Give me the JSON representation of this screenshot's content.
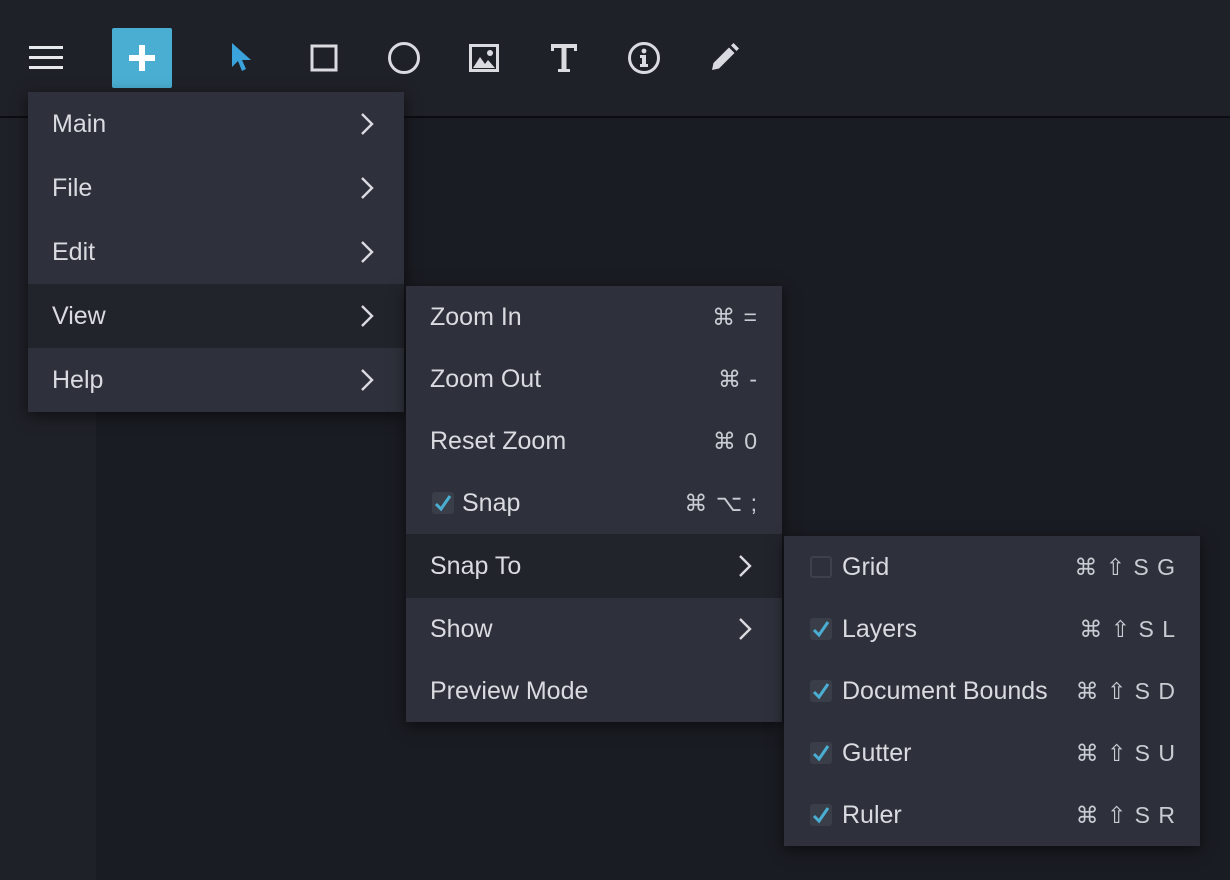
{
  "toolbar": {
    "tools": [
      {
        "name": "menu",
        "icon": "hamburger-icon"
      },
      {
        "name": "add",
        "icon": "plus-icon"
      },
      {
        "name": "select",
        "icon": "pointer-icon"
      },
      {
        "name": "rectangle",
        "icon": "square-icon"
      },
      {
        "name": "ellipse",
        "icon": "circle-icon"
      },
      {
        "name": "image",
        "icon": "image-icon"
      },
      {
        "name": "text",
        "icon": "text-icon"
      },
      {
        "name": "info",
        "icon": "info-icon"
      },
      {
        "name": "pen",
        "icon": "pencil-icon"
      }
    ],
    "accent_color": "#4aaed2",
    "pointer_color": "#3aa3dc"
  },
  "main_menu": {
    "items": [
      {
        "label": "Main"
      },
      {
        "label": "File"
      },
      {
        "label": "Edit"
      },
      {
        "label": "View",
        "active": true
      },
      {
        "label": "Help"
      }
    ]
  },
  "view_menu": {
    "items": [
      {
        "label": "Zoom In",
        "shortcut": "⌘ ="
      },
      {
        "label": "Zoom Out",
        "shortcut": "⌘ -"
      },
      {
        "label": "Reset Zoom",
        "shortcut": "⌘ 0"
      },
      {
        "label": "Snap",
        "shortcut": "⌘ ⌥ ;",
        "checked": true
      },
      {
        "label": "Snap To",
        "submenu": true,
        "active": true
      },
      {
        "label": "Show",
        "submenu": true
      },
      {
        "label": "Preview Mode"
      }
    ]
  },
  "snap_to_menu": {
    "items": [
      {
        "label": "Grid",
        "shortcut": "⌘ ⇧ S G",
        "checked": false
      },
      {
        "label": "Layers",
        "shortcut": "⌘ ⇧ S L",
        "checked": true
      },
      {
        "label": "Document Bounds",
        "shortcut": "⌘ ⇧ S D",
        "checked": true
      },
      {
        "label": "Gutter",
        "shortcut": "⌘ ⇧ S U",
        "checked": true
      },
      {
        "label": "Ruler",
        "shortcut": "⌘ ⇧ S R",
        "checked": true
      }
    ],
    "check_color": "#4aaed2"
  }
}
